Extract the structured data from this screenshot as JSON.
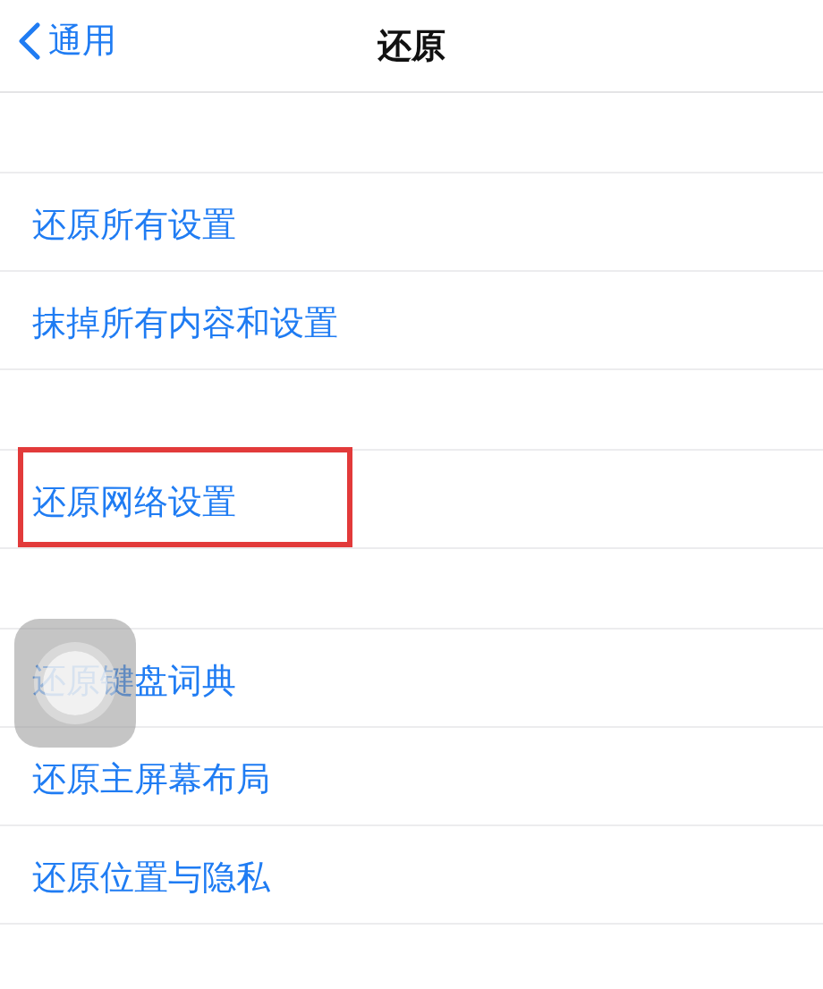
{
  "nav": {
    "back_label": "通用",
    "title": "还原"
  },
  "groups": [
    {
      "rows": [
        {
          "label": "还原所有设置",
          "highlighted": false
        },
        {
          "label": "抹掉所有内容和设置",
          "highlighted": false
        }
      ]
    },
    {
      "rows": [
        {
          "label": "还原网络设置",
          "highlighted": true
        }
      ]
    },
    {
      "rows": [
        {
          "label": "还原键盘词典",
          "highlighted": false
        },
        {
          "label": "还原主屏幕布局",
          "highlighted": false
        },
        {
          "label": "还原位置与隐私",
          "highlighted": false
        }
      ]
    }
  ]
}
